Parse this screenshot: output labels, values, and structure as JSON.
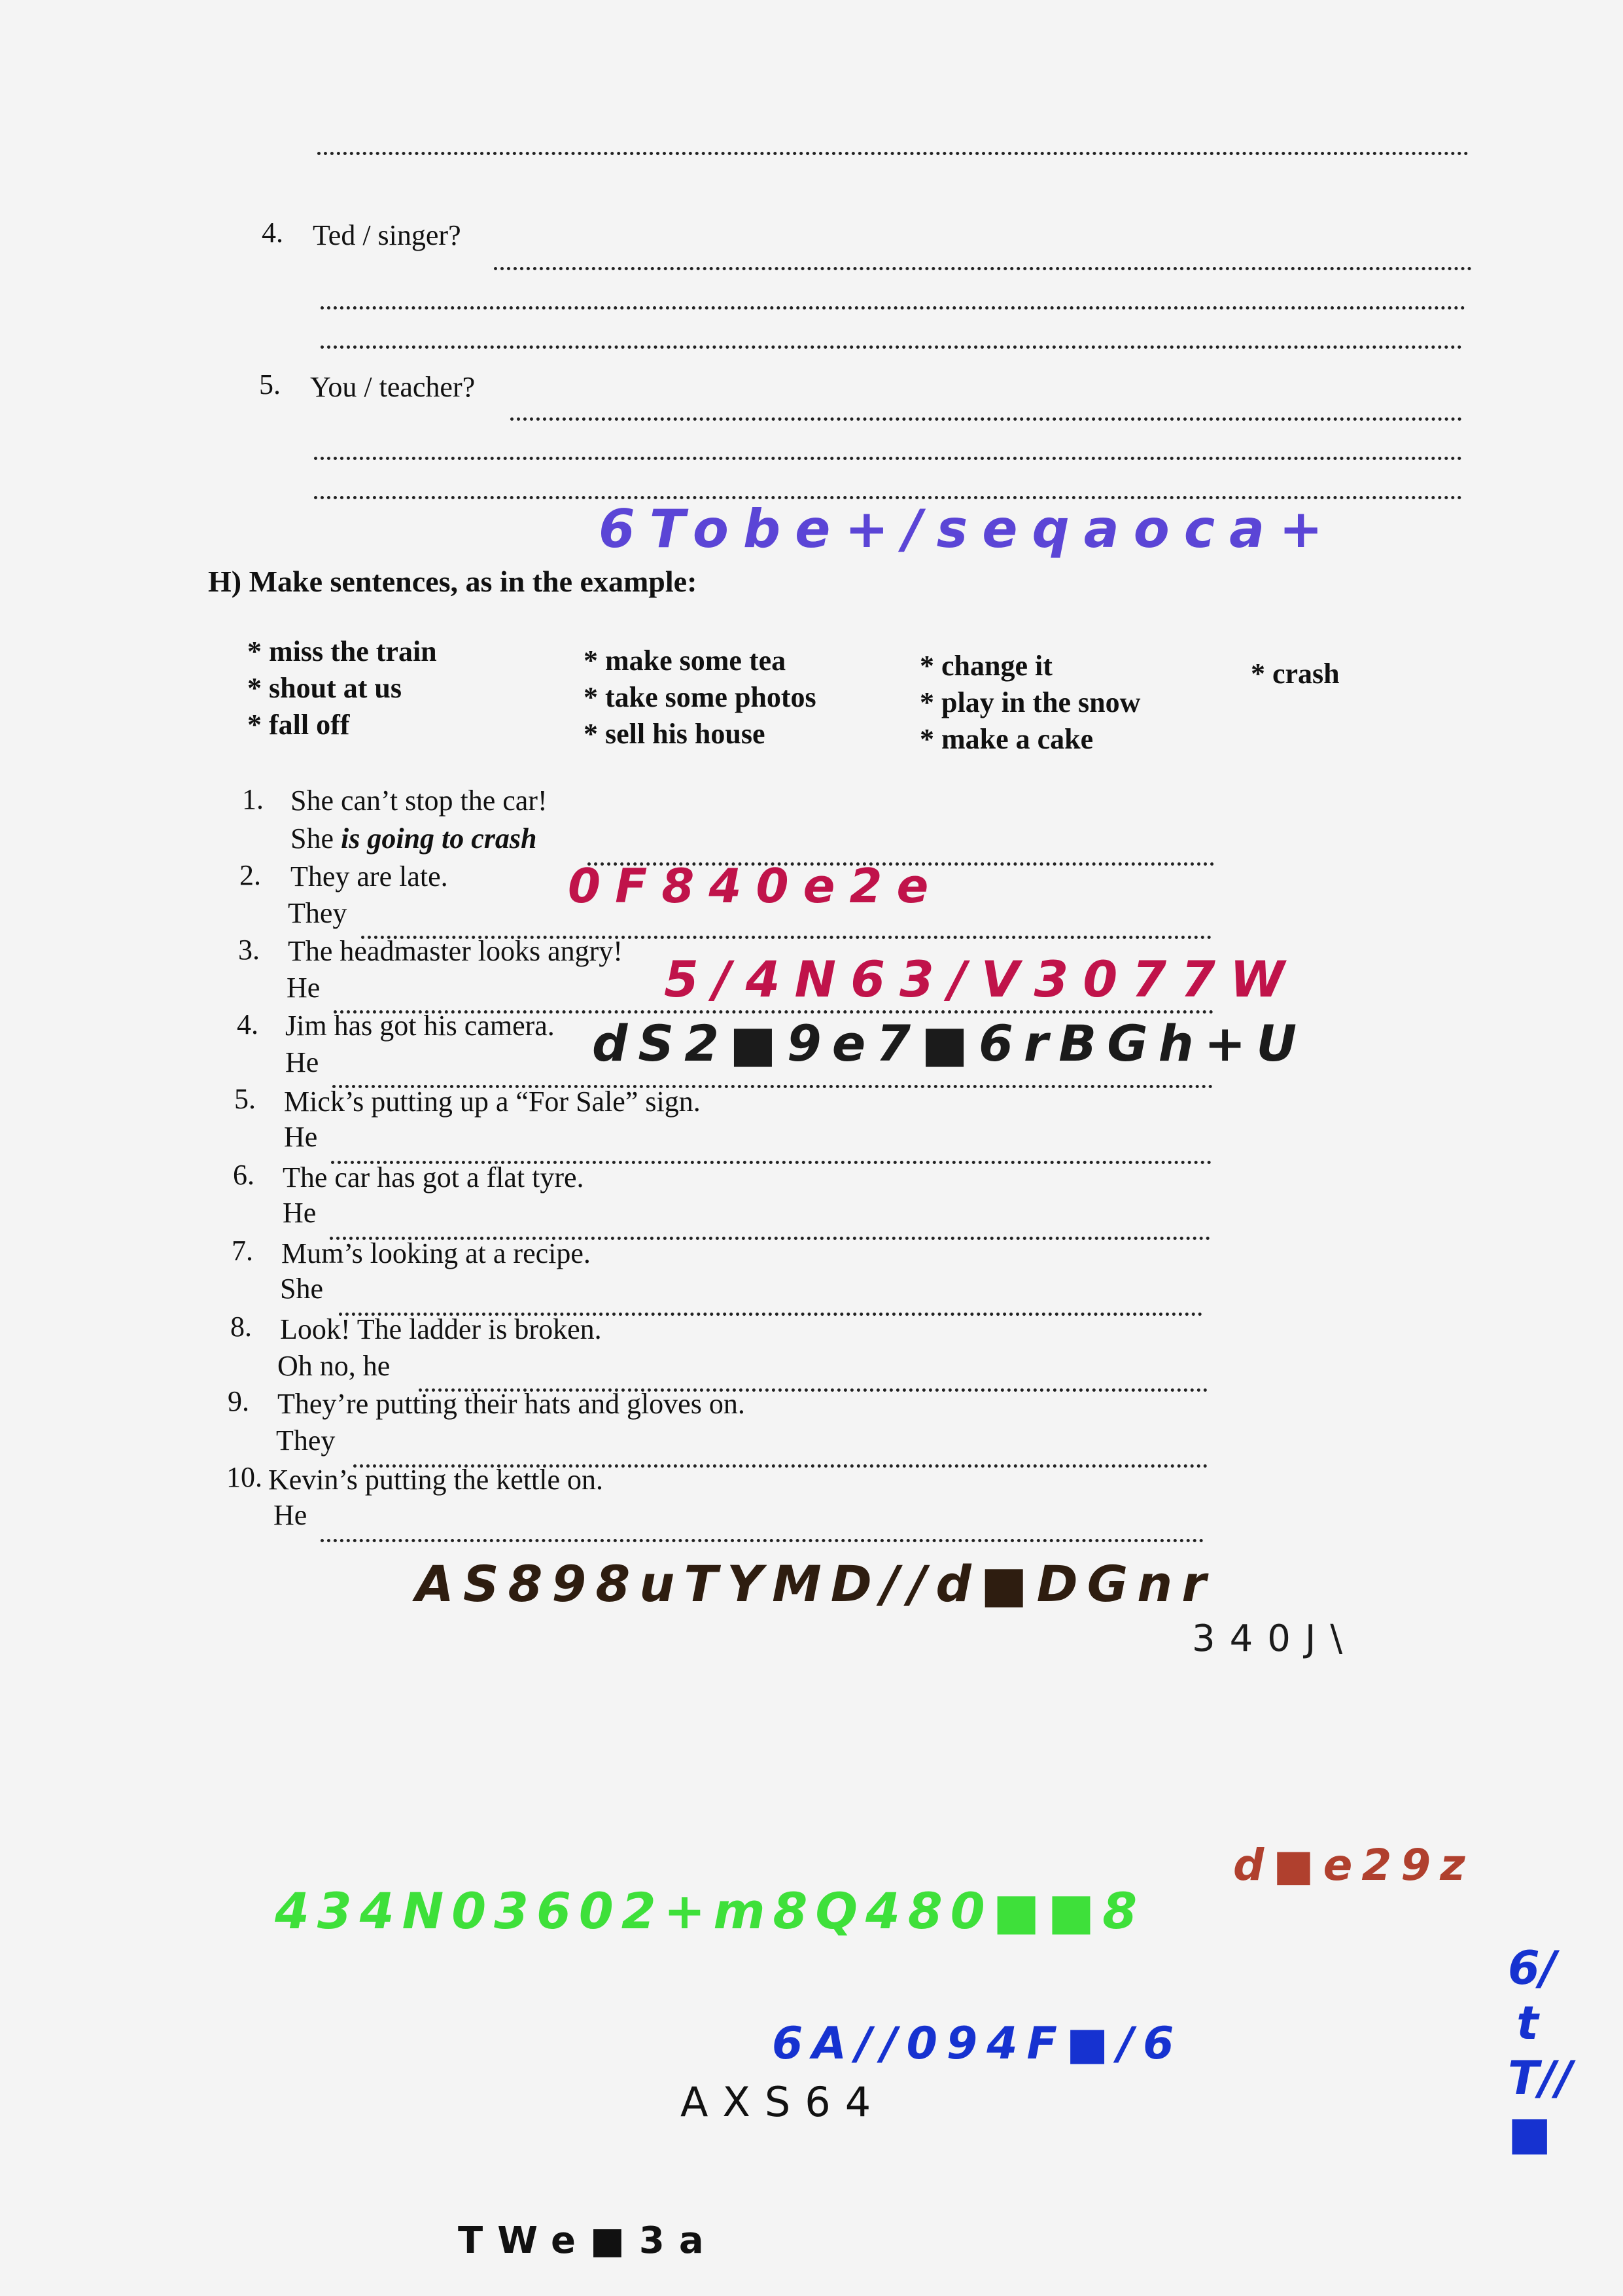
{
  "top_questions": [
    {
      "num": "4.",
      "text": "Ted / singer?"
    },
    {
      "num": "5.",
      "text": "You / teacher?"
    }
  ],
  "section_h": {
    "heading": "H) Make sentences, as in the example:",
    "options": [
      [
        "* miss the train",
        "* shout at us",
        "* fall off"
      ],
      [
        "* make some tea",
        "* take some photos",
        "* sell his house"
      ],
      [
        "* change it",
        "* play in the snow",
        "* make a cake"
      ],
      [
        "* crash"
      ]
    ],
    "items": [
      {
        "num": "1.",
        "prompt": "She can’t stop the car!",
        "start": "She",
        "example": "is going to crash"
      },
      {
        "num": "2.",
        "prompt": "They are late.",
        "start": "They"
      },
      {
        "num": "3.",
        "prompt": "The headmaster looks angry!",
        "start": "He"
      },
      {
        "num": "4.",
        "prompt": "Jim has got his camera.",
        "start": "He"
      },
      {
        "num": "5.",
        "prompt": "Mick’s putting up a “For Sale” sign.",
        "start": "He"
      },
      {
        "num": "6.",
        "prompt": "The car has got a flat tyre.",
        "start": "He"
      },
      {
        "num": "7.",
        "prompt": "Mum’s looking at a recipe.",
        "start": "She"
      },
      {
        "num": "8.",
        "prompt": "Look! The ladder is broken.",
        "start": "Oh no, he"
      },
      {
        "num": "9.",
        "prompt": "They’re putting their hats and gloves on.",
        "start": "They"
      },
      {
        "num": "10.",
        "prompt": "Kevin’s putting the kettle on.",
        "start": "He"
      }
    ]
  },
  "scribbles": {
    "purple_line": "6Tobe+/seqaoca+",
    "red_line_1": "0F840e2e",
    "red_line_2": "5/4N63/V3077W",
    "black_line_1": "dS2■9e7■6rBGh+U",
    "black_line_2": "AS898uTYMD//d■DGnr",
    "black_line_3": "340J\\",
    "brown_line": "d■e29z",
    "green_line": "434N03602+m8Q480■■8",
    "blue_line": "6A//094F■/6",
    "black_line_4": "AXS64",
    "black_line_5": "TWe■3a",
    "blue_vertical": "6/tT//■"
  },
  "colors": {
    "purple": "#5b45d6",
    "red": "#c0134a",
    "black_ink": "#1b1b1b",
    "brown_ink": "#2e1d10",
    "brown_red": "#b0402e",
    "green": "#3ee03a",
    "blue": "#1632d0"
  }
}
